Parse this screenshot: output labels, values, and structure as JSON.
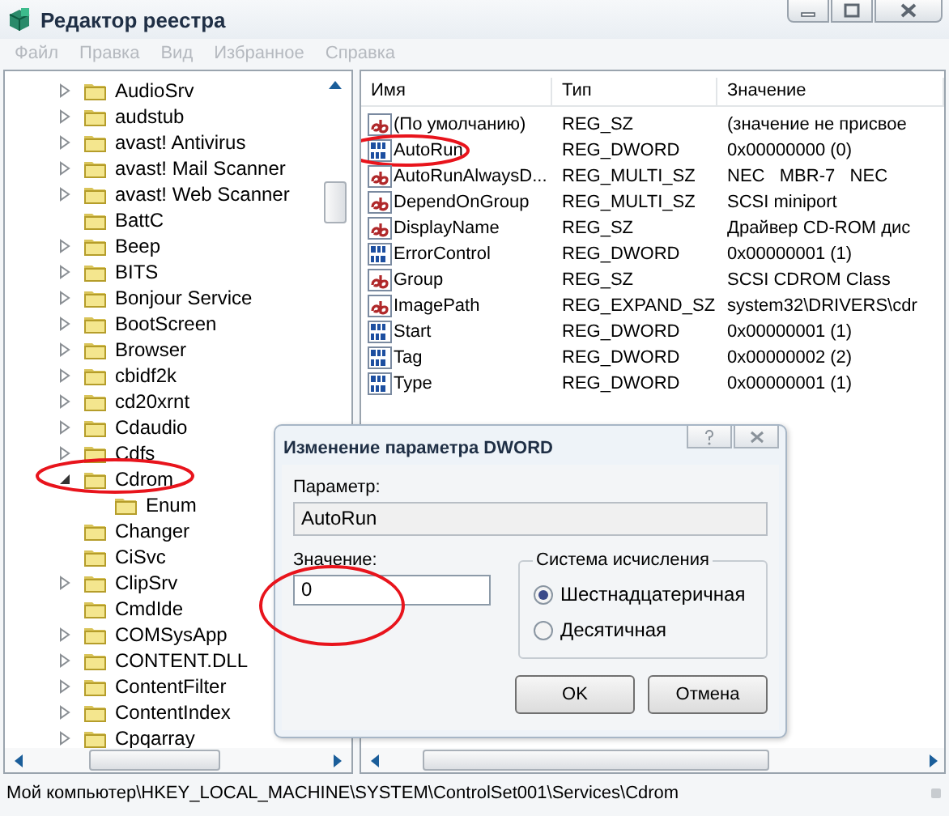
{
  "window": {
    "title": "Редактор реестра"
  },
  "menu": [
    {
      "label": "Файл",
      "disabled": true
    },
    {
      "label": "Правка",
      "disabled": true
    },
    {
      "label": "Вид",
      "disabled": true
    },
    {
      "label": "Избранное",
      "disabled": true
    },
    {
      "label": "Справка",
      "disabled": true
    }
  ],
  "tree": {
    "items": [
      {
        "label": "AudioSrv",
        "expanded": false
      },
      {
        "label": "audstub",
        "expanded": false
      },
      {
        "label": "avast! Antivirus",
        "expanded": false
      },
      {
        "label": "avast! Mail Scanner",
        "expanded": false
      },
      {
        "label": "avast! Web Scanner",
        "expanded": false
      },
      {
        "label": "BattC"
      },
      {
        "label": "Beep",
        "expanded": false
      },
      {
        "label": "BITS",
        "expanded": false
      },
      {
        "label": "Bonjour Service",
        "expanded": false
      },
      {
        "label": "BootScreen",
        "expanded": false
      },
      {
        "label": "Browser",
        "expanded": false
      },
      {
        "label": "cbidf2k",
        "expanded": false
      },
      {
        "label": "cd20xrnt",
        "expanded": false
      },
      {
        "label": "Cdaudio",
        "expanded": false
      },
      {
        "label": "Cdfs",
        "expanded": false
      },
      {
        "label": "Cdrom",
        "expanded": true,
        "circled": true,
        "children": [
          {
            "label": "Enum"
          }
        ]
      },
      {
        "label": "Changer"
      },
      {
        "label": "CiSvc"
      },
      {
        "label": "ClipSrv",
        "expanded": false
      },
      {
        "label": "CmdIde"
      },
      {
        "label": "COMSysApp",
        "expanded": false
      },
      {
        "label": "CONTENT.DLL",
        "expanded": false
      },
      {
        "label": "ContentFilter",
        "expanded": false
      },
      {
        "label": "ContentIndex",
        "expanded": false
      },
      {
        "label": "Cpqarray",
        "expanded": false
      }
    ]
  },
  "list": {
    "columns": [
      "Имя",
      "Тип",
      "Значение"
    ],
    "rows": [
      {
        "kind": "string",
        "name": "(По умолчанию)",
        "type": "REG_SZ",
        "value": "(значение не присвое",
        "circled": false
      },
      {
        "kind": "number",
        "name": "AutoRun",
        "type": "REG_DWORD",
        "value": "0x00000000 (0)",
        "circled": true
      },
      {
        "kind": "string",
        "name": "AutoRunAlwaysD...",
        "type": "REG_MULTI_SZ",
        "value": "NEC   MBR-7   NEC",
        "circled": false
      },
      {
        "kind": "string",
        "name": "DependOnGroup",
        "type": "REG_MULTI_SZ",
        "value": "SCSI miniport",
        "circled": false
      },
      {
        "kind": "string",
        "name": "DisplayName",
        "type": "REG_SZ",
        "value": "Драйвер CD-ROM дис",
        "circled": false
      },
      {
        "kind": "number",
        "name": "ErrorControl",
        "type": "REG_DWORD",
        "value": "0x00000001 (1)",
        "circled": false
      },
      {
        "kind": "string",
        "name": "Group",
        "type": "REG_SZ",
        "value": "SCSI CDROM Class",
        "circled": false
      },
      {
        "kind": "string",
        "name": "ImagePath",
        "type": "REG_EXPAND_SZ",
        "value": "system32\\DRIVERS\\cdr",
        "circled": false
      },
      {
        "kind": "number",
        "name": "Start",
        "type": "REG_DWORD",
        "value": "0x00000001 (1)",
        "circled": false
      },
      {
        "kind": "number",
        "name": "Tag",
        "type": "REG_DWORD",
        "value": "0x00000002 (2)",
        "circled": false
      },
      {
        "kind": "number",
        "name": "Type",
        "type": "REG_DWORD",
        "value": "0x00000001 (1)",
        "circled": false
      }
    ]
  },
  "status_bar": "Мой компьютер\\HKEY_LOCAL_MACHINE\\SYSTEM\\ControlSet001\\Services\\Cdrom",
  "dialog": {
    "title": "Изменение параметра DWORD",
    "parameter_label": "Параметр:",
    "parameter": "AutoRun",
    "value_label": "Значение:",
    "value": "0",
    "value_circled": true,
    "base_group": "Система исчисления",
    "bases": [
      {
        "label": "Шестнадцатеричная",
        "selected": true
      },
      {
        "label": "Десятичная",
        "selected": false
      }
    ],
    "buttons": [
      "OK",
      "Отмена"
    ]
  }
}
